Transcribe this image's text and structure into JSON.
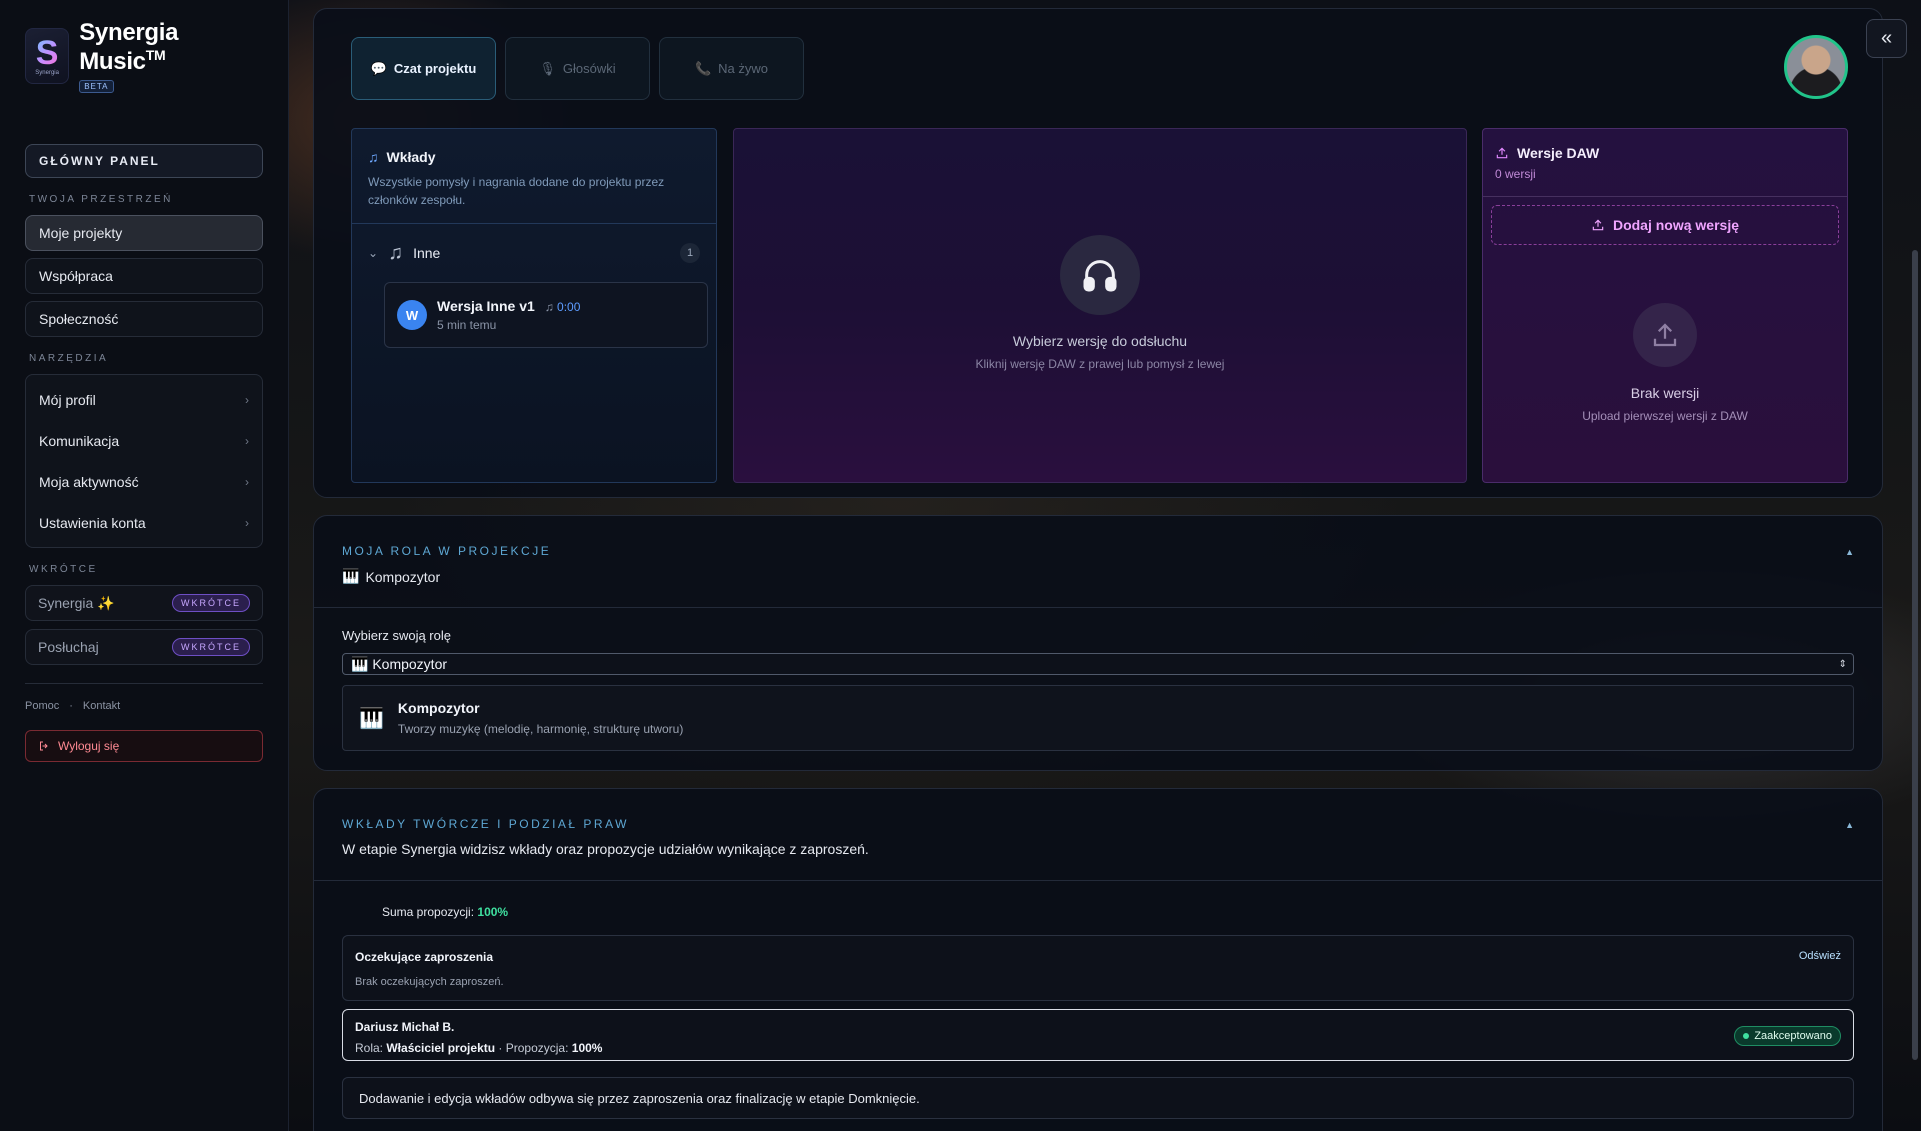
{
  "sidebar": {
    "brand": {
      "name": "Synergia Music",
      "tm": "TM",
      "badge": "BETA",
      "logo_letter": "S",
      "logo_text": "Synergia"
    },
    "main_panel": "GŁÓWNY PANEL",
    "workspace_label": "TWOJA PRZESTRZEŃ",
    "workspace_items": [
      "Moje projekty",
      "Współpraca",
      "Społeczność"
    ],
    "tools_label": "NARZĘDZIA",
    "tools_items": [
      "Mój profil",
      "Komunikacja",
      "Moja aktywność",
      "Ustawienia konta"
    ],
    "soon_label": "WKRÓTCE",
    "soon_items": [
      "Synergia ✨",
      "Posłuchaj"
    ],
    "soon_badge": "WKRÓTCE",
    "footer": {
      "help": "Pomoc",
      "sep": "·",
      "contact": "Kontakt"
    },
    "logout": "Wyloguj się"
  },
  "tabs": {
    "chat": "Czat projektu",
    "voice": "Głosówki",
    "live": "Na żywo"
  },
  "contributions": {
    "title": "Wkłady",
    "desc": "Wszystkie pomysły i nagrania dodane do projektu przez członków zespołu.",
    "group": {
      "name": "Inne",
      "count": "1"
    },
    "item": {
      "avatar": "W",
      "name": "Wersja Inne v1",
      "duration": "0:00",
      "time": "5 min temu"
    }
  },
  "player": {
    "title": "Wybierz wersję do odsłuchu",
    "subtitle": "Kliknij wersję DAW z prawej lub pomysł z lewej"
  },
  "daw": {
    "title": "Wersje DAW",
    "count": "0 wersji",
    "add": "Dodaj nową wersję",
    "empty_title": "Brak wersji",
    "empty_sub": "Upload pierwszej wersji z DAW"
  },
  "role": {
    "label": "MOJA ROLA W PROJEKCJE",
    "current": "Kompozytor",
    "select_label": "Wybierz swoją rolę",
    "selected": "Kompozytor",
    "box_title": "Kompozytor",
    "box_sub": "Tworzy muzykę (melodię, harmonię, strukturę utworu)"
  },
  "rights": {
    "label": "WKŁADY TWÓRCZE I PODZIAŁ PRAW",
    "desc": "W etapie Synergia widzisz wkłady oraz propozycje udziałów wynikające z zaproszeń.",
    "sum_label": "Suma propozycji:",
    "sum_value": "100%",
    "pending_title": "Oczekujące zaproszenia",
    "pending_empty": "Brak oczekujących zaproszeń.",
    "refresh": "Odśwież",
    "owner_name": "Dariusz Michał B.",
    "owner_role_label": "Rola:",
    "owner_role": "Właściciel projektu",
    "owner_prop_label": "· Propozycja:",
    "owner_prop": "100%",
    "accepted": "Zaakceptowano",
    "info": "Dodawanie i edycja wkładów odbywa się przez zaproszenia oraz finalizację w etapie Domknięcie."
  }
}
